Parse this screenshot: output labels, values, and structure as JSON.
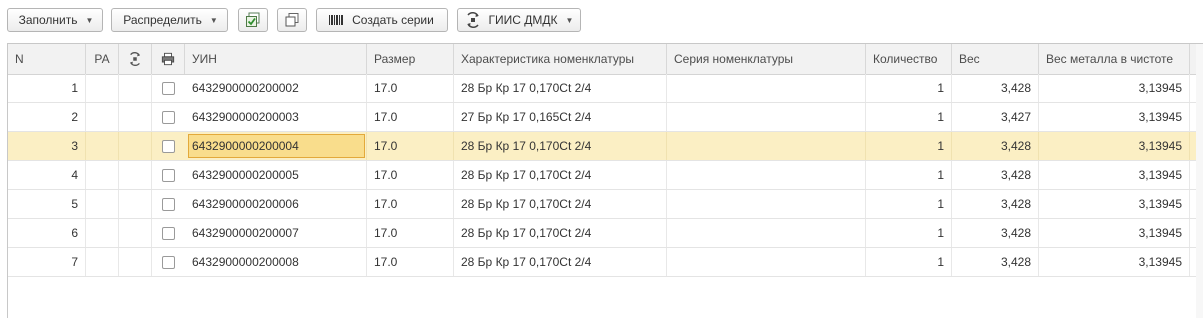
{
  "toolbar": {
    "fill_label": "Заполнить",
    "distribute_label": "Распределить",
    "create_series_label": "Создать серии",
    "giis_label": "ГИИС ДМДК"
  },
  "table": {
    "columns": {
      "n": "N",
      "ra": "РА",
      "uin": "УИН",
      "size": "Размер",
      "characteristic": "Характеристика номенклатуры",
      "series": "Серия номенклатуры",
      "quantity": "Количество",
      "weight": "Вес",
      "pure_weight": "Вес металла в чистоте"
    },
    "rows": [
      {
        "n": "1",
        "uin": "6432900000200002",
        "size": "17.0",
        "characteristic": "28 Бр Кр 17 0,170Ct 2/4",
        "series": "",
        "quantity": "1",
        "weight": "3,428",
        "pure_weight": "3,13945"
      },
      {
        "n": "2",
        "uin": "6432900000200003",
        "size": "17.0",
        "characteristic": "27 Бр Кр 17 0,165Ct 2/4",
        "series": "",
        "quantity": "1",
        "weight": "3,427",
        "pure_weight": "3,13945"
      },
      {
        "n": "3",
        "uin": "6432900000200004",
        "size": "17.0",
        "characteristic": "28 Бр Кр 17 0,170Ct 2/4",
        "series": "",
        "quantity": "1",
        "weight": "3,428",
        "pure_weight": "3,13945"
      },
      {
        "n": "4",
        "uin": "6432900000200005",
        "size": "17.0",
        "characteristic": "28 Бр Кр 17 0,170Ct 2/4",
        "series": "",
        "quantity": "1",
        "weight": "3,428",
        "pure_weight": "3,13945"
      },
      {
        "n": "5",
        "uin": "6432900000200006",
        "size": "17.0",
        "characteristic": "28 Бр Кр 17 0,170Ct 2/4",
        "series": "",
        "quantity": "1",
        "weight": "3,428",
        "pure_weight": "3,13945"
      },
      {
        "n": "6",
        "uin": "6432900000200007",
        "size": "17.0",
        "characteristic": "28 Бр Кр 17 0,170Ct 2/4",
        "series": "",
        "quantity": "1",
        "weight": "3,428",
        "pure_weight": "3,13945"
      },
      {
        "n": "7",
        "uin": "6432900000200008",
        "size": "17.0",
        "characteristic": "28 Бр Кр 17 0,170Ct 2/4",
        "series": "",
        "quantity": "1",
        "weight": "3,428",
        "pure_weight": "3,13945"
      }
    ],
    "selected_row": 3
  },
  "icons": {
    "check_all": "check-all-icon",
    "copy": "copy-icon",
    "barcode": "barcode-icon",
    "giis": "giis-dmdk-icon",
    "print_column": "printer-icon",
    "giis_column": "giis-status-icon"
  },
  "colors": {
    "selected_row": "#fbefc4",
    "focused_cell": "#f9dd8c",
    "header_bg": "#f2f2f2"
  }
}
